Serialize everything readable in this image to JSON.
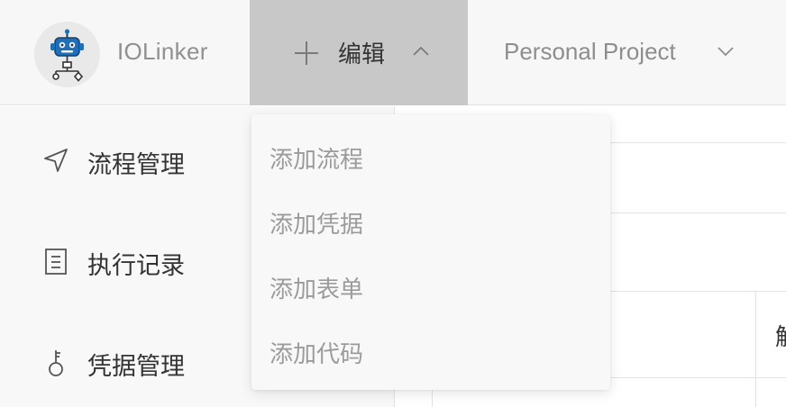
{
  "header": {
    "app_name": "IOLinker",
    "edit_menu": {
      "label": "编辑"
    },
    "project_selector": {
      "label": "Personal Project"
    }
  },
  "sidebar": {
    "items": [
      {
        "label": "流程管理",
        "icon": "send-icon"
      },
      {
        "label": "执行记录",
        "icon": "document-icon"
      },
      {
        "label": "凭据管理",
        "icon": "key-icon"
      }
    ]
  },
  "dropdown": {
    "items": [
      {
        "label": "添加流程"
      },
      {
        "label": "添加凭据"
      },
      {
        "label": "添加表单"
      },
      {
        "label": "添加代码"
      }
    ]
  },
  "table": {
    "column_header_partial": "触"
  },
  "colors": {
    "robot_blue": "#1f6fb8",
    "edit_menu_bg": "#c8c8c8",
    "header_bg": "#f7f7f7",
    "muted_text": "#9b9b9b"
  }
}
